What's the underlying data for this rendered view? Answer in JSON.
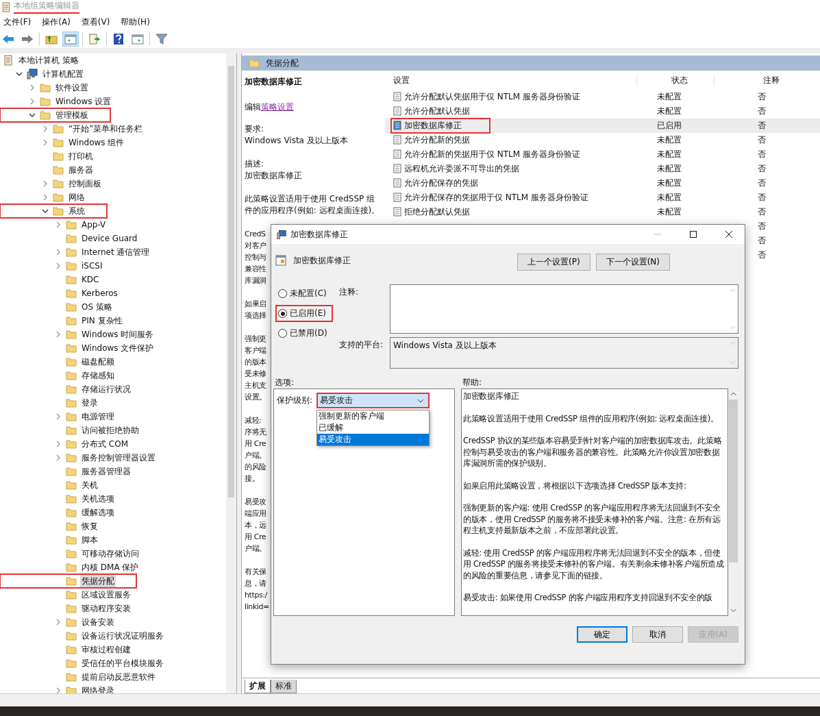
{
  "window": {
    "title": "本地组策略编辑器",
    "highlighted": true
  },
  "menu": [
    "文件(F)",
    "操作(A)",
    "查看(V)",
    "帮助(H)"
  ],
  "tree": [
    {
      "label": "本地计算机 策略",
      "kind": "policy",
      "selected": false,
      "children": [
        {
          "label": "计算机配置",
          "kind": "computer",
          "selected": false,
          "expanded": true,
          "children": [
            {
              "label": "软件设置",
              "kind": "folder",
              "selected": false,
              "expanded": false
            },
            {
              "label": "Windows 设置",
              "kind": "folder",
              "selected": false,
              "expanded": false
            },
            {
              "label": "管理模板",
              "kind": "folder",
              "selected": false,
              "expanded": true,
              "highlighted": true,
              "children": [
                {
                  "label": "“开始”菜单和任务栏",
                  "kind": "folder",
                  "selected": false,
                  "expanded": false
                },
                {
                  "label": "Windows 组件",
                  "kind": "folder",
                  "selected": false,
                  "expanded": false
                },
                {
                  "label": "打印机",
                  "kind": "folder",
                  "selected": false
                },
                {
                  "label": "服务器",
                  "kind": "folder",
                  "selected": false
                },
                {
                  "label": "控制面板",
                  "kind": "folder",
                  "selected": false,
                  "expanded": false
                },
                {
                  "label": "网络",
                  "kind": "folder",
                  "selected": false,
                  "expanded": false
                },
                {
                  "label": "系统",
                  "kind": "folder",
                  "selected": false,
                  "expanded": true,
                  "highlighted": true,
                  "children": [
                    {
                      "label": "App-V",
                      "kind": "folder",
                      "selected": false,
                      "expanded": false
                    },
                    {
                      "label": "Device Guard",
                      "kind": "folder",
                      "selected": false
                    },
                    {
                      "label": "Internet 通信管理",
                      "kind": "folder",
                      "selected": false,
                      "expanded": false
                    },
                    {
                      "label": "iSCSI",
                      "kind": "folder",
                      "selected": false,
                      "expanded": false
                    },
                    {
                      "label": "KDC",
                      "kind": "folder",
                      "selected": false
                    },
                    {
                      "label": "Kerberos",
                      "kind": "folder",
                      "selected": false
                    },
                    {
                      "label": "OS 策略",
                      "kind": "folder",
                      "selected": false
                    },
                    {
                      "label": "PIN 复杂性",
                      "kind": "folder",
                      "selected": false
                    },
                    {
                      "label": "Windows 时间服务",
                      "kind": "folder",
                      "selected": false,
                      "expanded": false
                    },
                    {
                      "label": "Windows 文件保护",
                      "kind": "folder",
                      "selected": false
                    },
                    {
                      "label": "磁盘配额",
                      "kind": "folder",
                      "selected": false
                    },
                    {
                      "label": "存储感知",
                      "kind": "folder",
                      "selected": false
                    },
                    {
                      "label": "存储运行状况",
                      "kind": "folder",
                      "selected": false
                    },
                    {
                      "label": "登录",
                      "kind": "folder",
                      "selected": false
                    },
                    {
                      "label": "电源管理",
                      "kind": "folder",
                      "selected": false,
                      "expanded": false
                    },
                    {
                      "label": "访问被拒绝协助",
                      "kind": "folder",
                      "selected": false
                    },
                    {
                      "label": "分布式 COM",
                      "kind": "folder",
                      "selected": false,
                      "expanded": false
                    },
                    {
                      "label": "服务控制管理器设置",
                      "kind": "folder",
                      "selected": false,
                      "expanded": false
                    },
                    {
                      "label": "服务器管理器",
                      "kind": "folder",
                      "selected": false
                    },
                    {
                      "label": "关机",
                      "kind": "folder",
                      "selected": false
                    },
                    {
                      "label": "关机选项",
                      "kind": "folder",
                      "selected": false
                    },
                    {
                      "label": "缓解选项",
                      "kind": "folder",
                      "selected": false
                    },
                    {
                      "label": "恢复",
                      "kind": "folder",
                      "selected": false
                    },
                    {
                      "label": "脚本",
                      "kind": "folder",
                      "selected": false
                    },
                    {
                      "label": "可移动存储访问",
                      "kind": "folder",
                      "selected": false
                    },
                    {
                      "label": "内核 DMA 保护",
                      "kind": "folder",
                      "selected": false
                    },
                    {
                      "label": "凭据分配",
                      "kind": "folder",
                      "selected": true,
                      "highlighted": true
                    },
                    {
                      "label": "区域设置服务",
                      "kind": "folder",
                      "selected": false
                    },
                    {
                      "label": "驱动程序安装",
                      "kind": "folder",
                      "selected": false
                    },
                    {
                      "label": "设备安装",
                      "kind": "folder",
                      "selected": false,
                      "expanded": false
                    },
                    {
                      "label": "设备运行状况证明服务",
                      "kind": "folder",
                      "selected": false
                    },
                    {
                      "label": "审核过程创建",
                      "kind": "folder",
                      "selected": false
                    },
                    {
                      "label": "受信任的平台模块服务",
                      "kind": "folder",
                      "selected": false
                    },
                    {
                      "label": "提前启动反恶意软件",
                      "kind": "folder",
                      "selected": false
                    },
                    {
                      "label": "网络登录",
                      "kind": "folder",
                      "selected": false,
                      "expanded": false
                    }
                  ]
                }
              ]
            }
          ]
        }
      ]
    }
  ],
  "panel": {
    "title": "凭据分配"
  },
  "description": {
    "title": "加密数据库修正",
    "edit_prefix": "编辑",
    "edit_link": "策略设置",
    "requirement_label": "要求:",
    "requirement": "Windows Vista 及以上版本",
    "description_label": "描述:",
    "description": "加密数据库修正",
    "summary": "此策略设置适用于使用 CredSSP 组件的应用程序(例如: 远程桌面连接)。",
    "fragments": [
      [
        "CredS",
        "对客户",
        "控制与",
        "兼容性",
        "库漏洞"
      ],
      [
        "如果启",
        "项选择"
      ],
      [
        "强制更",
        "客户端",
        "的版本",
        "受未修",
        "主机支",
        "设置。"
      ],
      [
        "减轻:",
        "序将无",
        "用 Cre",
        "户端。",
        "的风险",
        "接。"
      ],
      [
        "易受攻",
        "端应用",
        "本，远",
        "用 Cre",
        "户端。"
      ],
      [
        "有关保",
        "息，请",
        "https:/",
        "linkid="
      ]
    ]
  },
  "settings": {
    "columns": [
      "设置",
      "状态",
      "注释"
    ],
    "rows": [
      {
        "name": "允许分配默认凭据用于仅 NTLM 服务器身份验证",
        "state": "未配置",
        "note": "否",
        "selected": false,
        "enabled": false
      },
      {
        "name": "允许分配默认凭据",
        "state": "未配置",
        "note": "否",
        "selected": false,
        "enabled": false
      },
      {
        "name": "加密数据库修正",
        "state": "已启用",
        "note": "否",
        "selected": true,
        "enabled": true,
        "highlighted": true
      },
      {
        "name": "允许分配新的凭据",
        "state": "未配置",
        "note": "否",
        "selected": false,
        "enabled": false
      },
      {
        "name": "允许分配新的凭据用于仅 NTLM 服务器身份验证",
        "state": "未配置",
        "note": "否",
        "selected": false,
        "enabled": false
      },
      {
        "name": "远程机允许委派不可导出的凭据",
        "state": "未配置",
        "note": "否",
        "selected": false,
        "enabled": false
      },
      {
        "name": "允许分配保存的凭据",
        "state": "未配置",
        "note": "否",
        "selected": false,
        "enabled": false
      },
      {
        "name": "允许分配保存的凭据用于仅 NTLM 服务器身份验证",
        "state": "未配置",
        "note": "否",
        "selected": false,
        "enabled": false
      },
      {
        "name": "拒绝分配默认凭据",
        "state": "未配置",
        "note": "否",
        "selected": false,
        "enabled": false
      },
      {
        "note": "否",
        "selected": false
      },
      {
        "note": "否",
        "selected": false
      },
      {
        "note": "否",
        "selected": false
      }
    ]
  },
  "view_tabs": [
    {
      "label": "扩展",
      "selected": true
    },
    {
      "label": "标准",
      "selected": false
    }
  ],
  "dialog": {
    "title": "加密数据库修正",
    "heading": "加密数据库修正",
    "nav_buttons": [
      "上一个设置(P)",
      "下一个设置(N)"
    ],
    "states": [
      {
        "label": "未配置(C)",
        "selected": false
      },
      {
        "label": "已启用(E)",
        "selected": true,
        "highlighted": true
      },
      {
        "label": "已禁用(D)",
        "selected": false
      }
    ],
    "comment_label": "注释:",
    "platform_label": "支持的平台:",
    "platform": "Windows Vista 及以上版本",
    "options_label": "选项:",
    "help_label": "帮助:",
    "option": {
      "label": "保护级别:",
      "value": "易受攻击",
      "highlighted": true,
      "expanded": true,
      "choices": [
        {
          "label": "强制更新的客户端",
          "selected": false
        },
        {
          "label": "已缓解",
          "selected": false
        },
        {
          "label": "易受攻击",
          "selected": true
        }
      ]
    },
    "help": [
      "加密数据库修正",
      "此策略设置适用于使用 CredSSP 组件的应用程序(例如: 远程桌面连接)。",
      "CredSSP 协议的某些版本容易受到针对客户端的加密数据库攻击。此策略控制与易受攻击的客户端和服务器的兼容性。此策略允许你设置加密数据库漏洞所需的保护级别。",
      "如果启用此策略设置，将根据以下选项选择 CredSSP 版本支持:",
      "强制更新的客户端: 使用 CredSSP 的客户端应用程序将无法回退到不安全的版本，使用 CredSSP 的服务将不接受未修补的客户端。注意: 在所有远程主机支持最新版本之前，不应部署此设置。",
      "减轻: 使用 CredSSP 的客户端应用程序将无法回退到不安全的版本，但使用 CredSSP 的服务将接受未修补的客户端。有关剩余未修补客户端所造成的风险的重要信息，请参见下面的链接。",
      "易受攻击: 如果使用 CredSSP 的客户端应用程序支持回退到不安全的版"
    ],
    "buttons": [
      {
        "label": "确定",
        "kind": "default"
      },
      {
        "label": "取消",
        "kind": "normal"
      },
      {
        "label": "应用(A)",
        "kind": "disabled"
      }
    ]
  }
}
